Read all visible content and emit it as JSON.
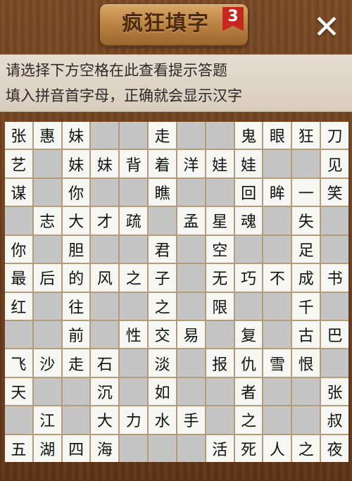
{
  "header": {
    "title": "疯狂填字",
    "level": "3",
    "close_icon": "close-x-icon"
  },
  "hint": {
    "line1": "请选择下方空格在此查看提示答题",
    "line2": "填入拼音首字母，正确就会显示汉字"
  },
  "colors": {
    "wood": "#6a3d1c",
    "plank": "#c48c4a",
    "badge": "#c4281e",
    "hint_bg": "#e3d9cb",
    "filled_cell": "#f6f6f3",
    "empty_cell": "#c5c5c5"
  },
  "grid": {
    "rows": [
      [
        "张",
        "惠",
        "妹",
        "",
        "",
        "走",
        "",
        "",
        "鬼",
        "眼",
        "狂",
        "刀"
      ],
      [
        "艺",
        "",
        "妹",
        "妹",
        "背",
        "着",
        "洋",
        "娃",
        "娃",
        "",
        "",
        "见"
      ],
      [
        "谋",
        "",
        "你",
        "",
        "",
        "瞧",
        "",
        "",
        "回",
        "眸",
        "一",
        "笑"
      ],
      [
        "",
        "志",
        "大",
        "才",
        "疏",
        "",
        "孟",
        "星",
        "魂",
        "",
        "失",
        ""
      ],
      [
        "你",
        "",
        "胆",
        "",
        "",
        "君",
        "",
        "空",
        "",
        "",
        "足",
        ""
      ],
      [
        "最",
        "后",
        "的",
        "风",
        "之",
        "子",
        "",
        "无",
        "巧",
        "不",
        "成",
        "书"
      ],
      [
        "红",
        "",
        "往",
        "",
        "",
        "之",
        "",
        "限",
        "",
        "",
        "千",
        ""
      ],
      [
        "",
        "",
        "前",
        "",
        "性",
        "交",
        "易",
        "",
        "复",
        "",
        "古",
        "巴"
      ],
      [
        "飞",
        "沙",
        "走",
        "石",
        "",
        "淡",
        "",
        "报",
        "仇",
        "雪",
        "恨",
        ""
      ],
      [
        "天",
        "",
        "",
        "沉",
        "",
        "如",
        "",
        "",
        "者",
        "",
        "",
        "张"
      ],
      [
        "",
        "江",
        "",
        "大",
        "力",
        "水",
        "手",
        "",
        "之",
        "",
        "",
        "叔"
      ],
      [
        "五",
        "湖",
        "四",
        "海",
        "",
        "",
        "",
        "活",
        "死",
        "人",
        "之",
        "夜"
      ]
    ]
  }
}
